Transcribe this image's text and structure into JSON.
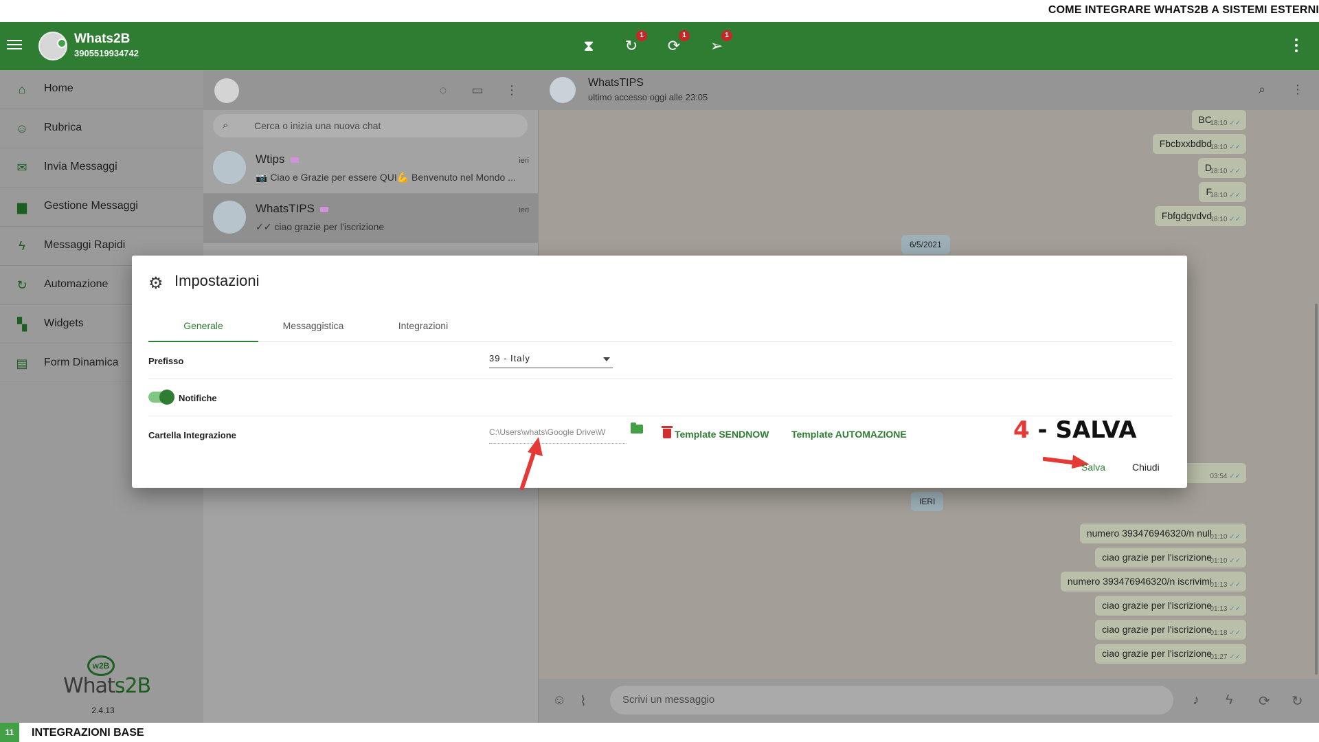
{
  "captions": {
    "top": "COME INTEGRARE WHATS2B A SISTEMI ESTERNI",
    "bottom_number": "11",
    "bottom": "INTEGRAZIONI BASE"
  },
  "header": {
    "app_name": "Whats2B",
    "phone": "3905519934742",
    "icons": [
      {
        "name": "hourglass-icon",
        "badge": ""
      },
      {
        "name": "refresh-clock-icon",
        "badge": "1"
      },
      {
        "name": "sync-icon",
        "badge": "1"
      },
      {
        "name": "scheduled-send-icon",
        "badge": "1"
      }
    ],
    "brand_color": "#2e7d32"
  },
  "sidebar": {
    "items": [
      {
        "label": "Home",
        "icon": "home-icon"
      },
      {
        "label": "Rubrica",
        "icon": "contacts-icon"
      },
      {
        "label": "Invia Messaggi",
        "icon": "mail-icon"
      },
      {
        "label": "Gestione Messaggi",
        "icon": "folder-icon"
      },
      {
        "label": "Messaggi Rapidi",
        "icon": "bolt-icon"
      },
      {
        "label": "Automazione",
        "icon": "automation-icon"
      },
      {
        "label": "Widgets",
        "icon": "widgets-icon"
      },
      {
        "label": "Form Dinamica",
        "icon": "form-icon"
      }
    ],
    "logo_badge": "w2B",
    "logo_text_a": "What",
    "logo_text_b": "s2B",
    "version": "2.4.13"
  },
  "chatlist": {
    "search_placeholder": "Cerca o inizia una nuova chat",
    "chats": [
      {
        "name": "Wtips",
        "preview": "📷 Ciao e Grazie per essere QUI💪 Benvenuto nel Mondo ...",
        "time": "ieri"
      },
      {
        "name": "WhatsTIPS",
        "preview": "✓✓ ciao grazie per l'iscrizione",
        "time": "ieri"
      }
    ]
  },
  "conversation": {
    "name": "WhatsTIPS",
    "status": "ultimo accesso oggi alle 23:05",
    "messages_top": [
      {
        "text": "BC",
        "time": "18:10"
      },
      {
        "text": "Fbcbxxbdbd",
        "time": "18:10"
      },
      {
        "text": "D",
        "time": "18:10"
      },
      {
        "text": "F",
        "time": "18:10"
      },
      {
        "text": "Fbfgdgvdvd",
        "time": "18:10"
      }
    ],
    "date_chip_1": "6/5/2021",
    "hidden_msg_time": "03:54",
    "date_chip_2": "IERI",
    "messages_bottom": [
      {
        "text": "numero 393476946320/n null",
        "time": "01:10"
      },
      {
        "text": "ciao grazie per l'iscrizione",
        "time": "01:10"
      },
      {
        "text": "numero 393476946320/n iscrivimi",
        "time": "01:13"
      },
      {
        "text": "ciao grazie per l'iscrizione",
        "time": "01:13"
      },
      {
        "text": "ciao grazie per l'iscrizione",
        "time": "01:18"
      },
      {
        "text": "ciao grazie per l'iscrizione",
        "time": "01:27"
      }
    ],
    "compose_placeholder": "Scrivi un messaggio"
  },
  "modal": {
    "title": "Impostazioni",
    "tabs": [
      "Generale",
      "Messaggistica",
      "Integrazioni"
    ],
    "active_tab": "Generale",
    "prefix_label": "Prefisso",
    "prefix_value": "39 - Italy",
    "notifications_label": "Notifiche",
    "notifications_on": true,
    "folder_label": "Cartella Integrazione",
    "folder_value": "C:\\Users\\whats\\Google Drive\\W",
    "template_sendnow": "Template SENDNOW",
    "template_automazione": "Template AUTOMAZIONE",
    "save": "Salva",
    "close": "Chiudi"
  },
  "annotation": {
    "number": "4",
    "text": " - SALVA",
    "color": "#e53935"
  }
}
